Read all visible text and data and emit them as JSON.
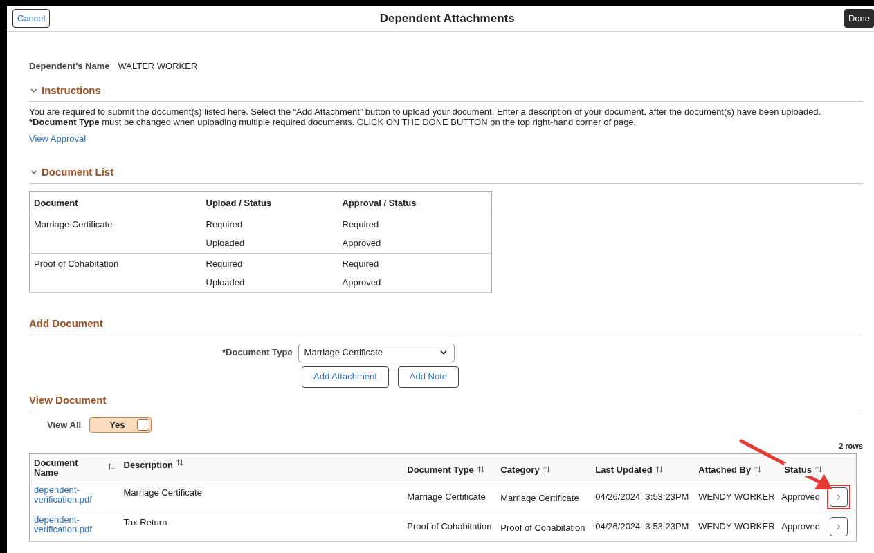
{
  "header": {
    "cancel": "Cancel",
    "title": "Dependent Attachments",
    "done": "Done"
  },
  "dependent": {
    "label": "Dependent's Name",
    "value": "WALTER WORKER"
  },
  "instructions": {
    "heading": "Instructions",
    "expanded": true,
    "text": "You are required to submit the document(s) listed here. Select the “Add Attachment” button to upload your document. Enter a description of your document, after the document(s) have been uploaded.",
    "text2": "***Document Type** must be changed when uploading multiple required documents. CLICK ON THE DONE BUTTON on the top right-hand corner of page.",
    "link": "View Approval"
  },
  "document_list": {
    "heading": "Document List",
    "expanded": true,
    "columns": [
      "Document",
      "Upload / Status",
      "Approval / Status"
    ],
    "rows": [
      {
        "document": "Marriage Certificate",
        "upload_status": [
          "Required",
          "Uploaded"
        ],
        "approval_status": [
          "Required",
          "Approved"
        ]
      },
      {
        "document": "Proof of Cohabitation",
        "upload_status": [
          "Required",
          "Uploaded"
        ],
        "approval_status": [
          "Required",
          "Approved"
        ]
      }
    ]
  },
  "add_document": {
    "heading": "Add Document",
    "type_label": "*Document Type",
    "type_value": "Marriage Certificate",
    "buttons": [
      "Add Attachment",
      "Add Note"
    ]
  },
  "view_document": {
    "heading": "View Document",
    "view_all_label": "View All",
    "view_all_value": "Yes",
    "view_all_on": true,
    "row_count": "2 rows",
    "columns": [
      "Document Name",
      "Description",
      "Document Type",
      "Category",
      "Last Updated",
      "Attached By",
      "Status"
    ],
    "rows": [
      {
        "file": "dependent-verification.pdf",
        "description": "Marriage Certificate",
        "document_type": "Marriage Certificate",
        "category": "Marriage Certificate",
        "last_updated": "04/26/2024  3:53:23PM",
        "attached_by": "WENDY WORKER",
        "status": "Approved",
        "highlighted": true
      },
      {
        "file": "dependent-verification.pdf",
        "description": "Tax Return",
        "document_type": "Proof of Cohabitation",
        "category": "Proof of Cohabitation",
        "last_updated": "04/26/2024  3:53:23PM",
        "attached_by": "WENDY WORKER",
        "status": "Approved",
        "highlighted": false
      }
    ]
  }
}
